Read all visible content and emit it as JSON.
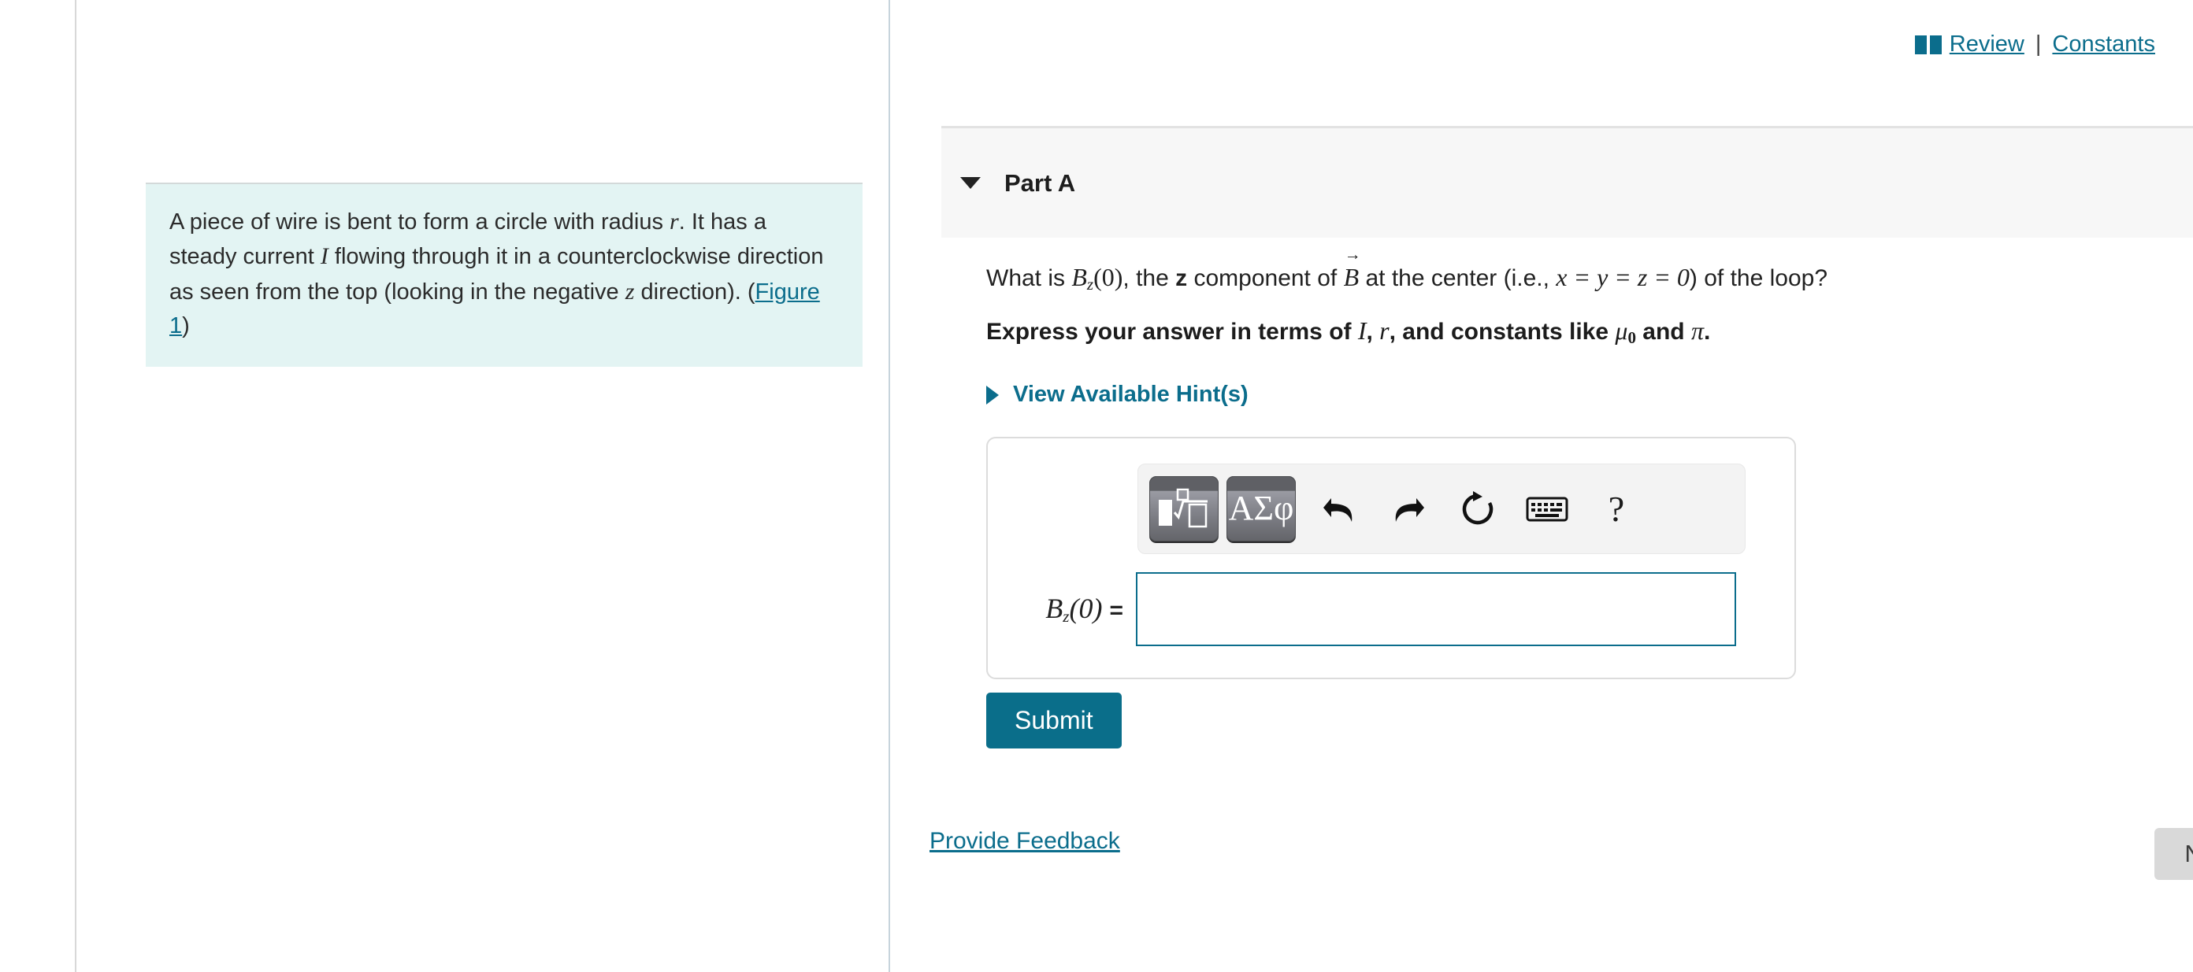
{
  "header": {
    "book_icon": "book-icon",
    "review_label": "Review",
    "separator": "|",
    "constants_label": "Constants"
  },
  "left_panel": {
    "problem_text_1": "A piece of wire is bent to form a circle with radius ",
    "radius_symbol": "r",
    "problem_text_2": ". It has a steady current ",
    "current_symbol": "I",
    "problem_text_3": " flowing through it in a counterclockwise direction as seen from the top (looking in the negative ",
    "axis_symbol": "z",
    "problem_text_4": " direction). (",
    "figure_link": "Figure 1",
    "problem_text_5": ")"
  },
  "part": {
    "title": "Part A",
    "toggle_icon": "chevron-down-icon"
  },
  "question": {
    "text_1": "What is ",
    "quantity": "B",
    "quantity_sub": "z",
    "quantity_arg": "(0)",
    "text_2": ", the ",
    "component": "z",
    "text_3": " component of ",
    "field_symbol": "B",
    "text_4": " at the center (i.e., ",
    "condition": "x = y = z = 0",
    "text_5": ") of the loop?",
    "instruction_1": "Express your answer in terms of ",
    "var_I": "I",
    "instruction_2": ", ",
    "var_r": "r",
    "instruction_3": ", and constants like ",
    "const_mu": "μ",
    "const_mu_sub": "0",
    "instruction_4": " and ",
    "const_pi": "π",
    "instruction_5": "."
  },
  "hints": {
    "label": "View Available Hint(s)",
    "toggle_icon": "chevron-right-icon"
  },
  "answer": {
    "label_base": "B",
    "label_sub": "z",
    "label_arg": "(0)",
    "label_eq": "=",
    "value": "",
    "placeholder": ""
  },
  "toolbar": {
    "buttons": [
      {
        "name": "math-template-button",
        "label": "math-template-icon"
      },
      {
        "name": "greek-letters-button",
        "label": "ΑΣφ"
      },
      {
        "name": "undo-button",
        "label": "undo-icon"
      },
      {
        "name": "redo-button",
        "label": "redo-icon"
      },
      {
        "name": "reset-button",
        "label": "reset-icon"
      },
      {
        "name": "keyboard-button",
        "label": "keyboard-icon"
      },
      {
        "name": "help-button",
        "label": "?"
      }
    ],
    "help_glyph": "?"
  },
  "actions": {
    "submit_label": "Submit",
    "feedback_label": "Provide Feedback",
    "next_label": "Next",
    "next_chevron": "❯"
  },
  "colors": {
    "teal": "#0b6d8c",
    "submit_bg": "#0a6e8a",
    "problem_bg": "#e3f4f3",
    "part_header_bg": "#f7f7f7",
    "next_bg": "#d9d9d9"
  }
}
